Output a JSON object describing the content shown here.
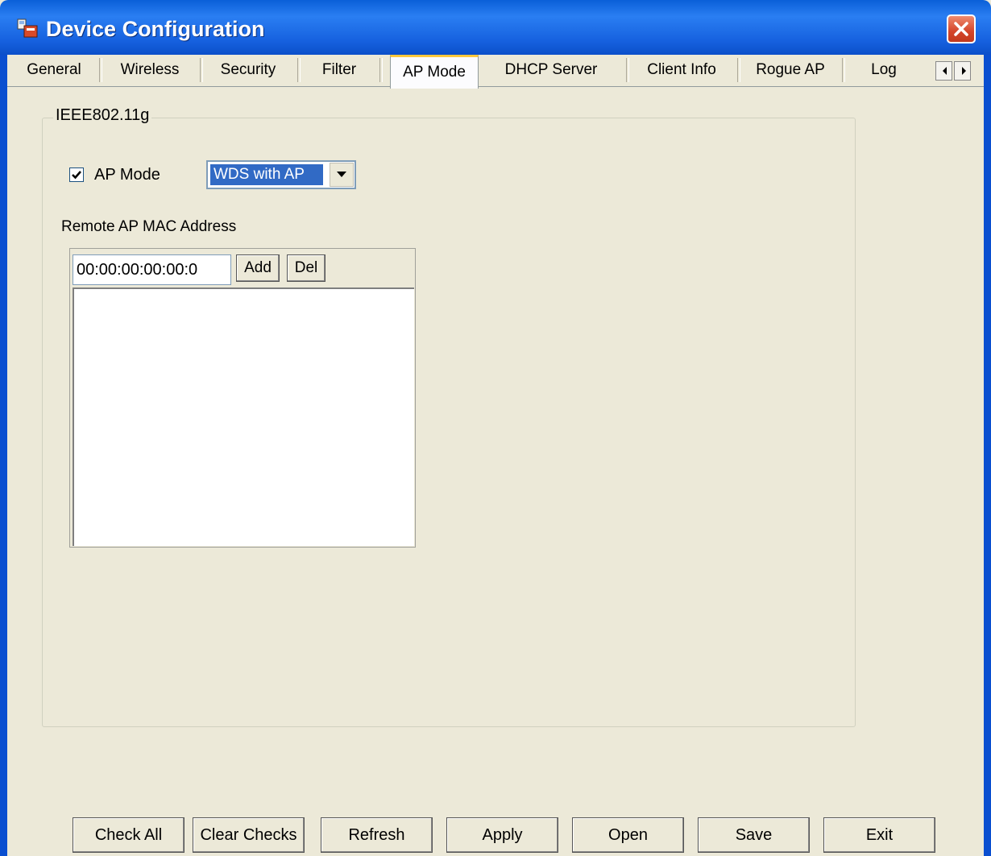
{
  "window": {
    "title": "Device Configuration"
  },
  "tabs": [
    {
      "label": "General"
    },
    {
      "label": "Wireless"
    },
    {
      "label": "Security"
    },
    {
      "label": "Filter"
    },
    {
      "label": "AP Mode",
      "active": true
    },
    {
      "label": "DHCP Server"
    },
    {
      "label": "Client Info"
    },
    {
      "label": "Rogue AP"
    },
    {
      "label": "Log"
    }
  ],
  "group": {
    "label": "IEEE802.11g"
  },
  "ap_mode": {
    "label": "AP Mode",
    "checked": true,
    "selected_value": "WDS with AP"
  },
  "remote": {
    "label": "Remote AP MAC Address",
    "mac_value": "00:00:00:00:00:0",
    "add_label": "Add",
    "del_label": "Del",
    "entries": []
  },
  "buttons": {
    "check_all": "Check All",
    "clear_checks": "Clear Checks",
    "refresh": "Refresh",
    "apply": "Apply",
    "open": "Open",
    "save": "Save",
    "exit": "Exit"
  },
  "icons": {
    "app": "device-config-icon",
    "close": "close-icon",
    "scroll_left": "arrow-left-icon",
    "scroll_right": "arrow-right-icon",
    "dropdown": "chevron-down-icon",
    "check": "checkmark-icon"
  },
  "colors": {
    "titlebar": "#0a5fd8",
    "window_bg": "#ece9d8",
    "close_button": "#d4452a",
    "selection": "#316ac5",
    "active_tab_accent": "#ffc83c"
  }
}
